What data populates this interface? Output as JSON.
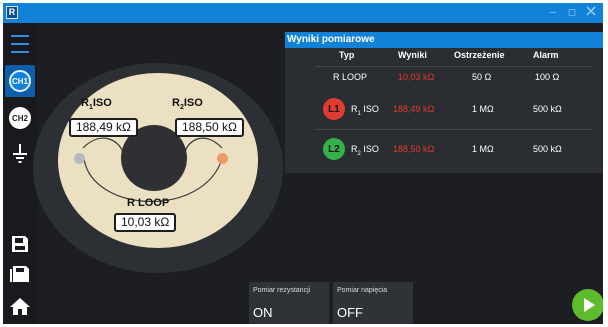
{
  "window": {
    "logo_letter": "R",
    "minimize": "–",
    "maximize": "◻"
  },
  "sidebar": {
    "items": [
      {
        "name": "menu",
        "icon": "hamburger-icon"
      },
      {
        "name": "ch1",
        "label": "CH1"
      },
      {
        "name": "ch2",
        "label": "CH2"
      },
      {
        "name": "ground",
        "icon": "ground-icon"
      },
      {
        "name": "save",
        "icon": "save-icon"
      },
      {
        "name": "memory",
        "icon": "memory-icon"
      },
      {
        "name": "home",
        "icon": "home-icon"
      }
    ]
  },
  "diagram": {
    "r1_label_main": "R",
    "r1_label_sub": "1",
    "r1_label_suffix": "ISO",
    "r1_value": "188,49 kΩ",
    "r2_label_main": "R",
    "r2_label_sub": "2",
    "r2_label_suffix": "ISO",
    "r2_value": "188,50 kΩ",
    "rloop_label": "R LOOP",
    "rloop_value": "10,03 kΩ"
  },
  "results": {
    "title": "Wyniki pomiarowe",
    "columns": [
      "Typ",
      "Wyniki",
      "Ostrzeżenie",
      "Alarm"
    ],
    "rows": [
      {
        "badge": "",
        "type_main": "R LOOP",
        "type_sub": "",
        "type_suffix": "",
        "result": "10,03 kΩ",
        "warning": "50 Ω",
        "alarm": "100 Ω"
      },
      {
        "badge": "L1",
        "type_main": "R",
        "type_sub": "1",
        "type_suffix": " ISO",
        "result": "188,49 kΩ",
        "warning": "1 MΩ",
        "alarm": "500 kΩ"
      },
      {
        "badge": "L2",
        "type_main": "R",
        "type_sub": "2",
        "type_suffix": " ISO",
        "result": "188,50 kΩ",
        "warning": "1 MΩ",
        "alarm": "500 kΩ"
      }
    ]
  },
  "controls": {
    "resistance": {
      "label": "Pomiar rezystancji",
      "value": "ON"
    },
    "voltage": {
      "label": "Pomiar napięcia",
      "value": "OFF"
    }
  },
  "colors": {
    "accent": "#1282d8",
    "alarm_red": "#e33b2c",
    "l1_badge": "#df3b2e",
    "l2_badge": "#33b24a",
    "play_green": "#5dbb2c",
    "disc": "#ece0c2"
  }
}
